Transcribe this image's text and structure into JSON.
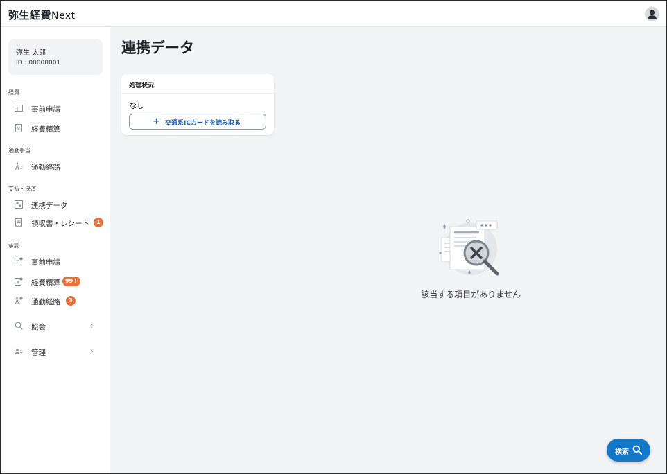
{
  "header": {
    "brand_main": "弥生経費",
    "brand_suffix": "Next"
  },
  "user": {
    "name": "弥生 太郎",
    "id": "ID : 00000001"
  },
  "sidebar": {
    "sections": [
      {
        "label": "経費"
      },
      {
        "label": "通勤手当"
      },
      {
        "label": "支払・決済"
      },
      {
        "label": "承認"
      }
    ],
    "items": [
      {
        "label": "事前申請",
        "icon": "pre-application-icon"
      },
      {
        "label": "経費精算",
        "icon": "expense-document-icon"
      },
      {
        "label": "通勤経路",
        "icon": "commute-walker-icon"
      },
      {
        "label": "連携データ",
        "icon": "linked-data-icon"
      },
      {
        "label": "領収書・レシート",
        "icon": "receipt-icon",
        "badge": "1"
      },
      {
        "label": "事前申請",
        "icon": "approval-pre-application-icon"
      },
      {
        "label": "経費精算",
        "icon": "approval-expense-icon",
        "badge": "99+"
      },
      {
        "label": "通勤経路",
        "icon": "approval-commute-icon",
        "badge": "3"
      },
      {
        "label": "照会",
        "icon": "inquiry-magnifier-icon"
      },
      {
        "label": "管理",
        "icon": "management-users-icon"
      }
    ]
  },
  "main": {
    "title": "連携データ",
    "status_card": {
      "heading": "処理状況",
      "value": "なし",
      "button_label": "交通系ICカードを読み取る"
    },
    "empty_message": "該当する項目がありません",
    "search_button_label": "検索"
  },
  "colors": {
    "accent": "#1478c8",
    "badge": "#e8733a",
    "background": "#f2f3f5"
  }
}
